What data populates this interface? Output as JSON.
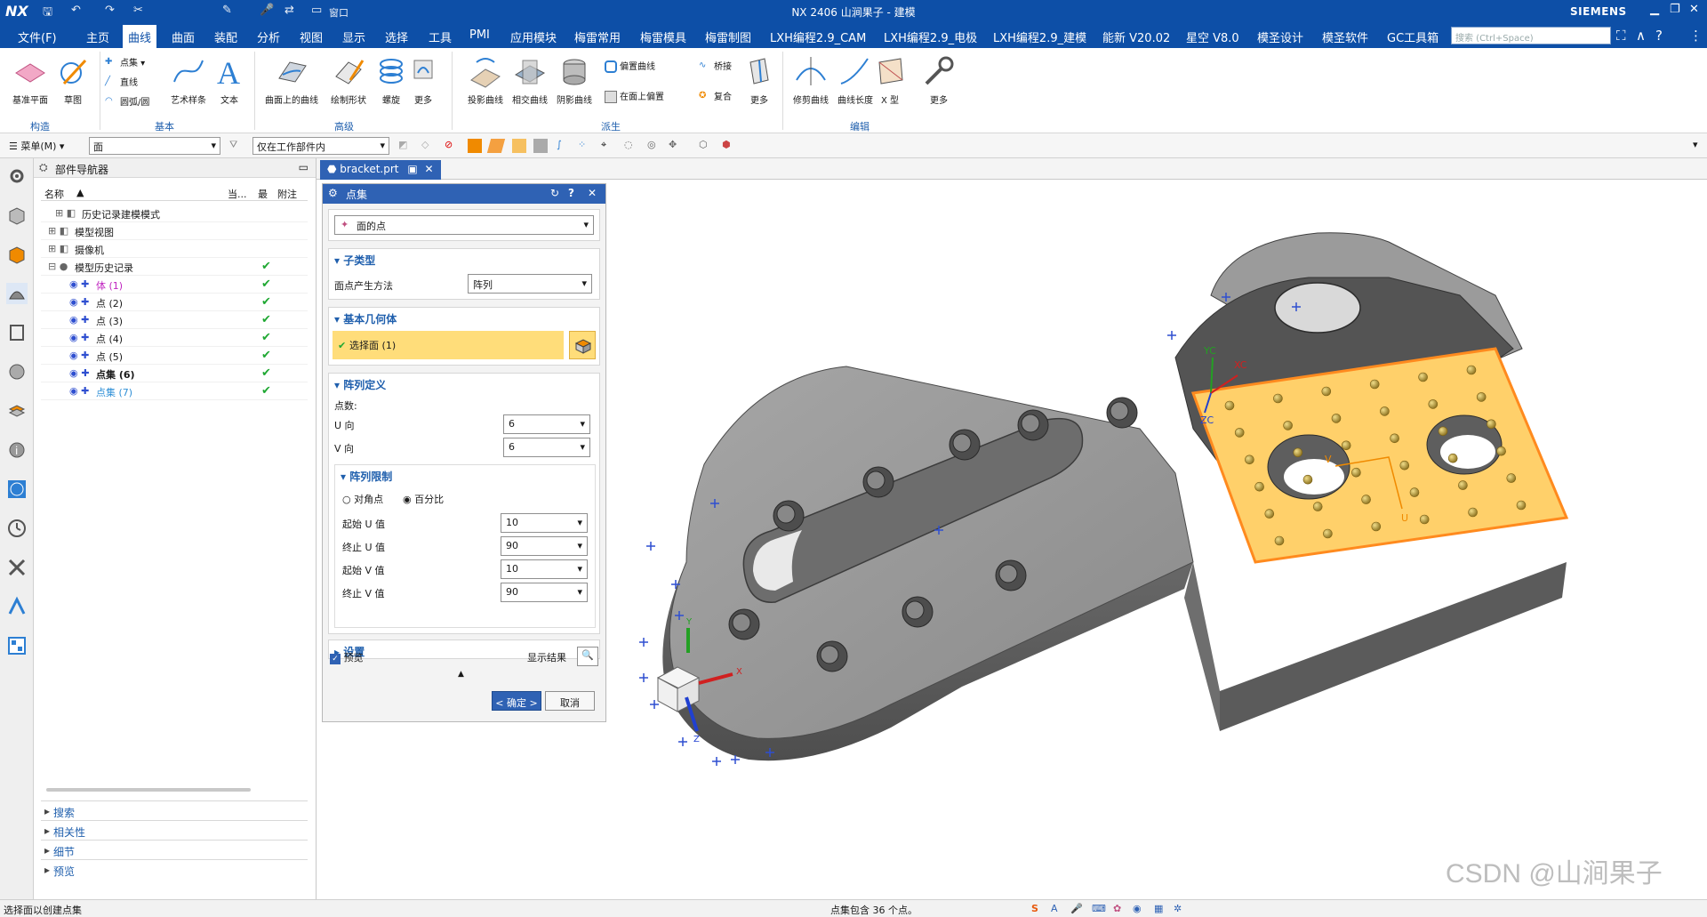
{
  "titlebar": {
    "logo": "NX",
    "title": "NX 2406 山涧果子 - 建模",
    "window_menu": "窗口",
    "brand": "SIEMENS"
  },
  "menubar": {
    "items": [
      "文件(F)",
      "主页",
      "曲线",
      "曲面",
      "装配",
      "分析",
      "视图",
      "显示",
      "选择",
      "工具",
      "PMI",
      "应用模块",
      "梅雷常用",
      "梅雷模具",
      "梅雷制图",
      "LXH编程2.9_CAM",
      "LXH编程2.9_电极",
      "LXH编程2.9_建模",
      "能新 V20.02",
      "星空 V8.0",
      "模圣设计",
      "模圣软件",
      "GC工具箱"
    ],
    "active": "曲线",
    "search_placeholder": "搜索 (Ctrl+Space)"
  },
  "ribbon": {
    "groups": {
      "construct": "构造",
      "basic": "基本",
      "advanced": "高级",
      "derived": "派生",
      "edit": "编辑"
    },
    "buttons": {
      "datum_plane": "基准平面",
      "sketch": "草图",
      "point": "点集",
      "line": "直线",
      "arc": "圆弧/圆",
      "art_spline": "艺术样条",
      "text": "文本",
      "curve_on_surface": "曲面上的曲线",
      "draw_shape": "绘制形状",
      "helix": "螺旋",
      "more1": "更多",
      "project_curve": "投影曲线",
      "intersect_curve": "相交曲线",
      "silhouette_curve": "阴影曲线",
      "offset_curve": "偏置曲线",
      "bridge": "桥接",
      "offset_on_face": "在面上偏置",
      "composite": "复合",
      "more2": "更多",
      "trim_curve": "修剪曲线",
      "curve_length": "曲线长度",
      "x_form": "X 型",
      "more3": "更多"
    }
  },
  "toolbar": {
    "menu": "菜单(M)",
    "filter": "面",
    "scope": "仅在工作部件内"
  },
  "navigator": {
    "title": "部件导航器",
    "columns": [
      "名称",
      "当...",
      "最",
      "附注"
    ],
    "rows": [
      {
        "label": "历史记录建模模式",
        "check": false
      },
      {
        "label": "模型视图",
        "check": false
      },
      {
        "label": "摄像机",
        "check": false
      },
      {
        "label": "模型历史记录",
        "check": true
      },
      {
        "label": "体 (1)",
        "check": true
      },
      {
        "label": "点 (2)",
        "check": true
      },
      {
        "label": "点 (3)",
        "check": true
      },
      {
        "label": "点 (4)",
        "check": true
      },
      {
        "label": "点 (5)",
        "check": true
      },
      {
        "label": "点集 (6)",
        "check": true
      },
      {
        "label": "点集 (7)",
        "check": true
      }
    ],
    "sections": [
      "搜索",
      "相关性",
      "细节",
      "预览"
    ]
  },
  "tab": {
    "filename": "bracket.prt"
  },
  "dialog": {
    "title": "点集",
    "type": "面的点",
    "subtype_title": "子类型",
    "method_label": "面点产生方法",
    "method_value": "阵列",
    "base_geom_title": "基本几何体",
    "select_face": "选择面 (1)",
    "array_def_title": "阵列定义",
    "point_count": "点数:",
    "u_label": "U 向",
    "u_value": "6",
    "v_label": "V 向",
    "v_value": "6",
    "limits_title": "阵列限制",
    "opt_corner": "对角点",
    "opt_percent": "百分比",
    "start_u_label": "起始 U 值",
    "start_u": "10",
    "end_u_label": "终止 U 值",
    "end_u": "90",
    "start_v_label": "起始 V 值",
    "start_v": "10",
    "end_v_label": "终止 V 值",
    "end_v": "90",
    "settings_title": "设置",
    "preview_label": "预览",
    "show_result": "显示结果",
    "ok": "< 确定 >",
    "cancel": "取消"
  },
  "viewport": {
    "axis_x": "X",
    "axis_y": "Y",
    "axis_z": "Z",
    "wcs_xc": "XC",
    "wcs_yc": "YC",
    "wcs_zc": "ZC",
    "face_u": "U",
    "face_v": "V",
    "watermark": "CSDN @山涧果子"
  },
  "statusbar": {
    "left": "选择面以创建点集",
    "center": "点集包含 36 个点。"
  },
  "colors": {
    "titlebar": "#0d4fa7",
    "selected_face": "#ffd06a",
    "face_edge": "#ff8a1e",
    "point_marker": "#a88d2a",
    "model_gray": "#8c8c8c"
  }
}
